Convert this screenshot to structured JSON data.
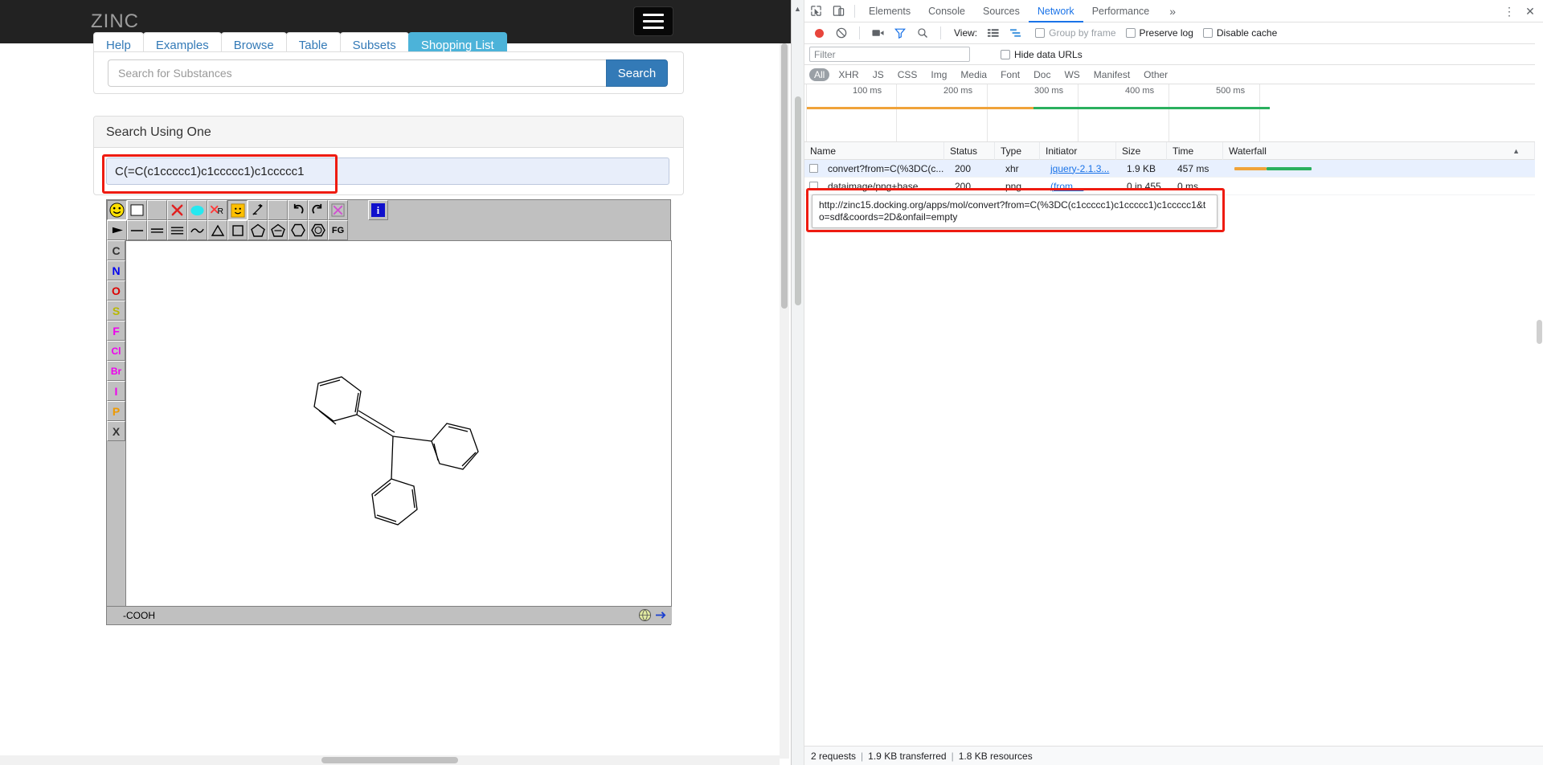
{
  "browser": {
    "brand": "ZINC",
    "menu_icon": "hamburger-icon",
    "tabs": [
      {
        "label": "Help",
        "active": false
      },
      {
        "label": "Examples",
        "active": false
      },
      {
        "label": "Browse",
        "active": false
      },
      {
        "label": "Table",
        "active": false
      },
      {
        "label": "Subsets",
        "active": false
      },
      {
        "label": "Shopping List",
        "active": true
      }
    ],
    "search": {
      "placeholder": "Search for Substances",
      "value": "",
      "button_label": "Search"
    },
    "panel": {
      "title": "Search Using One",
      "smiles_value": "C(=C(c1ccccc1)c1ccccc1)c1ccccc1",
      "smiles_placeholder": ""
    },
    "editor": {
      "toolbar_row1": [
        {
          "name": "smiley-yellow-icon",
          "glyph": "☺",
          "selected": true
        },
        {
          "name": "new-blank-icon",
          "glyph": "□",
          "selected": false
        },
        {
          "name": "spacer-1",
          "glyph": "",
          "selected": false
        },
        {
          "name": "delete-x-icon",
          "glyph": "✕",
          "selected": false
        },
        {
          "name": "highlight-blob-icon",
          "glyph": "●",
          "selected": false
        },
        {
          "name": "reaction-r-icon",
          "glyph": "R",
          "selected": false
        },
        {
          "name": "smiley-orange-icon",
          "glyph": "☺",
          "selected": true
        },
        {
          "name": "charge-plus-minus-icon",
          "glyph": "+/-",
          "selected": false
        },
        {
          "name": "spacer-2",
          "glyph": "",
          "selected": false
        },
        {
          "name": "undo-icon",
          "glyph": "↶",
          "selected": false
        },
        {
          "name": "redo-icon",
          "glyph": "↷",
          "selected": false
        },
        {
          "name": "clear-x-icon",
          "glyph": "✕",
          "selected": false
        },
        {
          "name": "spacer-3",
          "glyph": "",
          "selected": false
        },
        {
          "name": "info-icon",
          "glyph": "i",
          "selected": false
        }
      ],
      "toolbar_row2": [
        {
          "name": "stereo-wedge-icon",
          "glyph": "◀"
        },
        {
          "name": "single-bond-icon",
          "glyph": "—"
        },
        {
          "name": "double-bond-icon",
          "glyph": "="
        },
        {
          "name": "triple-bond-icon",
          "glyph": "≡"
        },
        {
          "name": "chain-icon",
          "glyph": "∿"
        },
        {
          "name": "ring-3-icon",
          "glyph": "△"
        },
        {
          "name": "ring-4-icon",
          "glyph": "□"
        },
        {
          "name": "ring-5-icon",
          "glyph": "⬠"
        },
        {
          "name": "furan-icon",
          "glyph": "⬠"
        },
        {
          "name": "ring-6-icon",
          "glyph": "⬡"
        },
        {
          "name": "benzene-icon",
          "glyph": "⬡"
        },
        {
          "name": "functional-group-icon",
          "glyph": "FG"
        }
      ],
      "palette": [
        "C",
        "N",
        "O",
        "S",
        "F",
        "Cl",
        "Br",
        "I",
        "P",
        "X"
      ],
      "palette_colors": {
        "C": "#333333",
        "N": "#0000ee",
        "O": "#dd0000",
        "S": "#b8b800",
        "F": "#ee00ee",
        "Cl": "#ee00ee",
        "Br": "#ee00ee",
        "I": "#ee00ee",
        "P": "#ee9900",
        "X": "#333333"
      },
      "status_text": "-COOH",
      "status_icons": [
        "globe-icon",
        "arrow-right-icon"
      ]
    }
  },
  "devtools": {
    "left_icons": [
      "inspect-element-icon",
      "device-toolbar-icon"
    ],
    "tabs": [
      {
        "label": "Elements",
        "active": false
      },
      {
        "label": "Console",
        "active": false
      },
      {
        "label": "Sources",
        "active": false
      },
      {
        "label": "Network",
        "active": true
      },
      {
        "label": "Performance",
        "active": false
      }
    ],
    "more_tabs_label": "»",
    "menu_icon": "vertical-dots-icon",
    "close_icon": "close-icon",
    "network_toolbar": {
      "record_icon": "record-icon",
      "clear_icon": "clear-icon",
      "screenshot_icon": "camera-icon",
      "filter_icon": "funnel-icon",
      "search_icon": "search-icon",
      "view_label": "View:",
      "view_list_icon": "list-view-icon",
      "view_waterfall_icon": "waterfall-view-icon",
      "group_by_frame_label": "Group by frame",
      "preserve_log_label": "Preserve log",
      "disable_cache_label": "Disable cache"
    },
    "filter": {
      "placeholder": "Filter",
      "value": "",
      "hide_data_urls_label": "Hide data URLs"
    },
    "type_filters": [
      {
        "label": "All",
        "active": true
      },
      {
        "label": "XHR",
        "active": false
      },
      {
        "label": "JS",
        "active": false
      },
      {
        "label": "CSS",
        "active": false
      },
      {
        "label": "Img",
        "active": false
      },
      {
        "label": "Media",
        "active": false
      },
      {
        "label": "Font",
        "active": false
      },
      {
        "label": "Doc",
        "active": false
      },
      {
        "label": "WS",
        "active": false
      },
      {
        "label": "Manifest",
        "active": false
      },
      {
        "label": "Other",
        "active": false
      }
    ],
    "overview": {
      "ticks": [
        "100 ms",
        "200 ms",
        "300 ms",
        "400 ms",
        "500 ms"
      ]
    },
    "columns": [
      "Name",
      "Status",
      "Type",
      "Initiator",
      "Size",
      "Time",
      "Waterfall"
    ],
    "sort_indicator": "▲",
    "rows": [
      {
        "name": "convert?from=C(%3DC(c...",
        "status": "200",
        "type": "xhr",
        "initiator": "jquery-2.1.3...",
        "size": "1.9 KB",
        "time": "457 ms",
        "selected": true
      },
      {
        "name": "dataimage/png+base...",
        "status": "200",
        "type": "png",
        "initiator": "(from ...",
        "size": "0 in 455...",
        "time": "0 ms",
        "selected": false
      }
    ],
    "tooltip_url": "http://zinc15.docking.org/apps/mol/convert?from=C(%3DC(c1ccccc1)c1ccccc1)c1ccccc1&to=sdf&coords=2D&onfail=empty",
    "footer": {
      "requests": "2 requests",
      "transferred": "1.9 KB transferred",
      "resources": "1.8 KB resources"
    }
  },
  "colors": {
    "accent_blue": "#1a73e8",
    "tab_active": "#4cb3d9",
    "annotation_red": "#ee1b11",
    "header_dark": "#222222",
    "search_btn": "#337ab7"
  }
}
